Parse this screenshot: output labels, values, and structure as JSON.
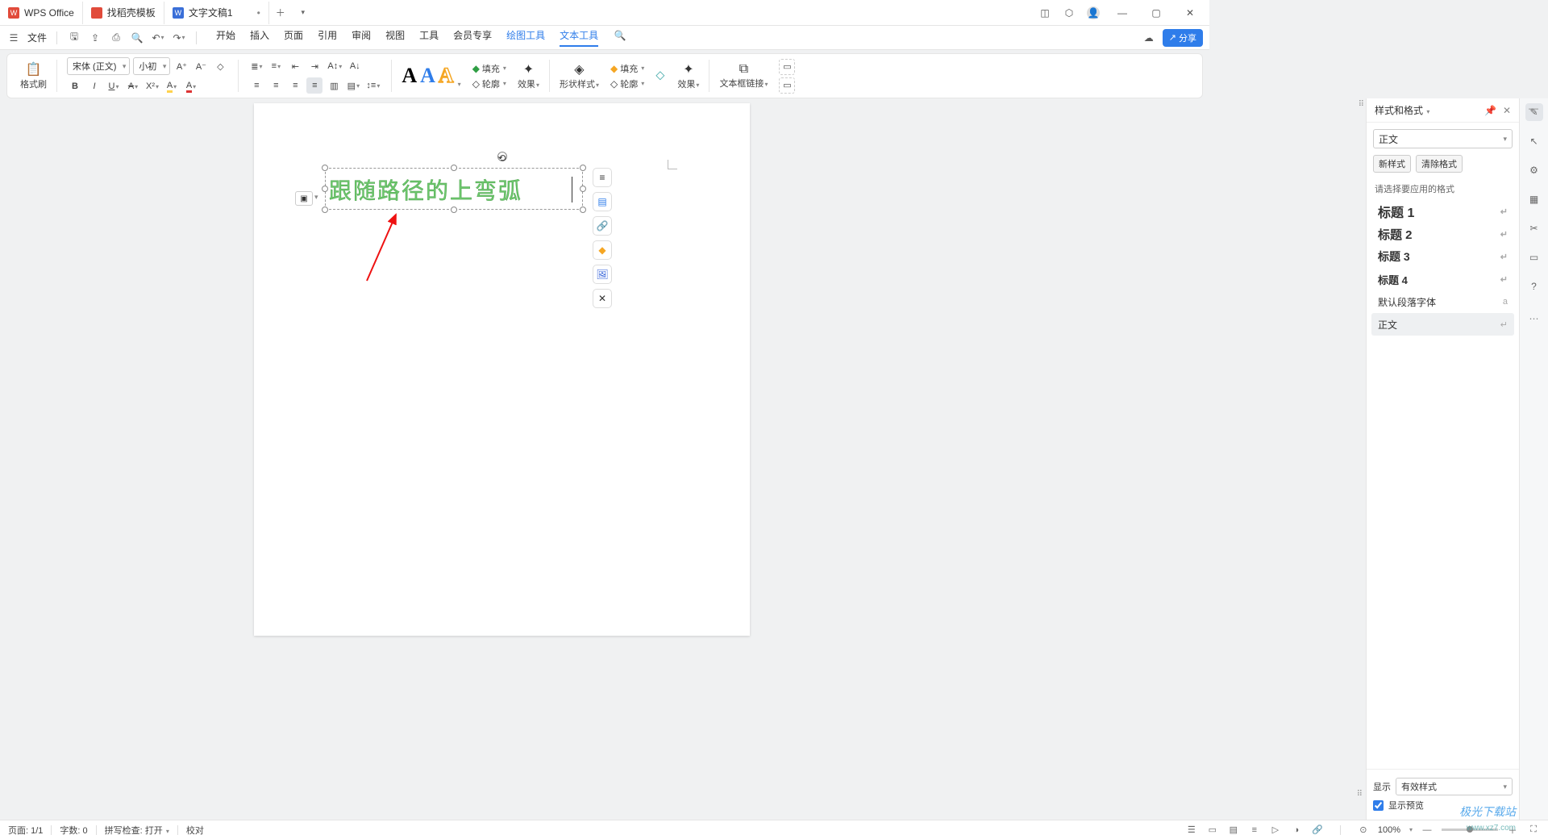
{
  "titlebar": {
    "app_name": "WPS Office",
    "tabs": [
      {
        "label": "找稻壳模板",
        "icon_color": "#e14b3b"
      },
      {
        "label": "文字文稿1",
        "icon_color": "#3a6fd8"
      }
    ]
  },
  "menubar": {
    "file": "文件",
    "items": [
      "开始",
      "插入",
      "页面",
      "引用",
      "审阅",
      "视图",
      "工具",
      "会员专享",
      "绘图工具",
      "文本工具"
    ],
    "share": "分享"
  },
  "ribbon": {
    "format_painter": "格式刷",
    "font_name": "宋体 (正文)",
    "font_size": "小初",
    "wordart_group": {
      "fill": "填充",
      "outline": "轮廓",
      "effect": "效果"
    },
    "shape_style": "形状样式",
    "shape_group": {
      "fill": "填充",
      "outline": "轮廓",
      "effect": "效果"
    },
    "textbox_link": "文本框链接"
  },
  "document": {
    "wordart_text": "跟随路径的上弯弧"
  },
  "sidepanel": {
    "title": "样式和格式",
    "current": "正文",
    "new_style": "新样式",
    "clear": "清除格式",
    "hint": "请选择要应用的格式",
    "items": [
      {
        "label": "标题 1",
        "cls": "h1"
      },
      {
        "label": "标题 2",
        "cls": "h2"
      },
      {
        "label": "标题 3",
        "cls": "h3"
      },
      {
        "label": "标题 4",
        "cls": "h4"
      },
      {
        "label": "默认段落字体",
        "cls": ""
      },
      {
        "label": "正文",
        "cls": "sel"
      }
    ],
    "display": "显示",
    "display_value": "有效样式",
    "preview": "显示预览"
  },
  "statusbar": {
    "page": "页面: 1/1",
    "words": "字数: 0",
    "spell": "拼写检查: 打开",
    "proof": "校对",
    "zoom": "100%"
  },
  "watermark": {
    "line1": "极光下载站",
    "line2": "www.xz7.com"
  }
}
